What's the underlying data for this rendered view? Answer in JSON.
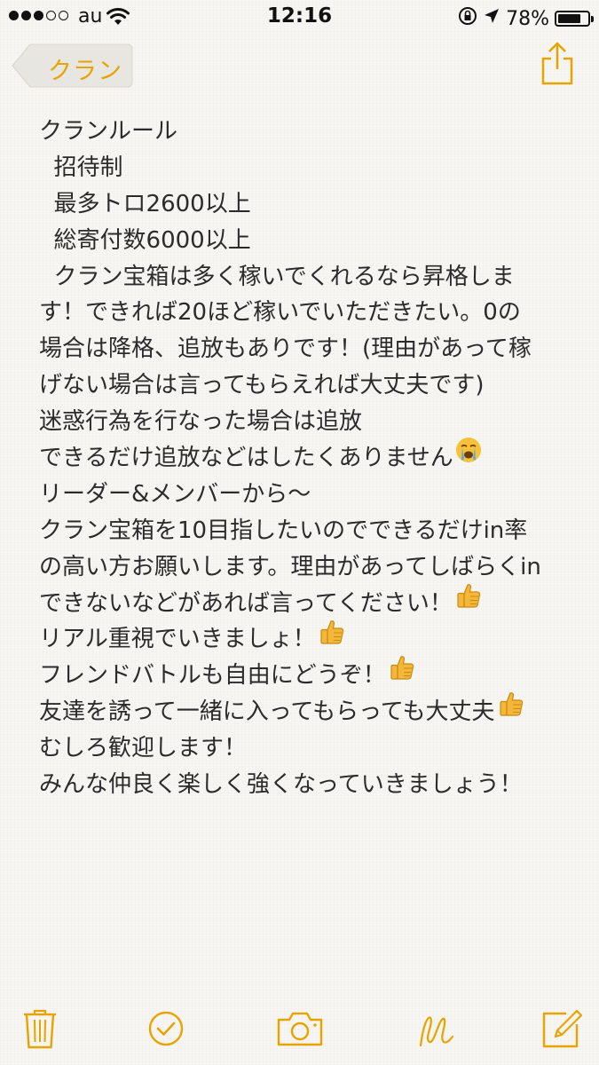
{
  "status_bar": {
    "carrier": "au",
    "time": "12:16",
    "battery": "78%",
    "battery_level": 0.78,
    "signal_bars_filled": 3,
    "signal_bars_total": 5
  },
  "nav": {
    "back_label": "クラン",
    "back_icon": "back-arrow-icon",
    "share_icon": "share-icon"
  },
  "note": {
    "lines": [
      "クランルール",
      "  招待制",
      "  最多トロ2600以上",
      "  総寄付数6000以上",
      "  クラン宝箱は多く稼いでくれるなら昇格しま",
      "す！できれば20ほど稼いでいただきたい。0の",
      "場合は降格、追放もありです！(理由があって稼",
      "げない場合は言ってもらえれば大丈夫です)",
      "迷惑行為を行なった場合は追放",
      "できるだけ追放などはしたくありません",
      "リーダー&メンバーから〜",
      "クラン宝箱を10目指したいのでできるだけin率",
      "の高い方お願いします。理由があってしばらくin",
      "できないなどがあれば言ってください！",
      "リアル重視でいきましょ！",
      "フレンドバトルも自由にどうぞ！",
      "友達を誘って一緒に入ってもらっても大丈夫",
      "むしろ歓迎します！",
      "みんな仲良く楽しく強くなっていきましょう！"
    ]
  },
  "toolbar": {
    "icons": [
      "trash-icon",
      "checklist-icon",
      "camera-icon",
      "sketch-icon",
      "compose-icon"
    ]
  },
  "colors": {
    "accent": "#e7a400",
    "text": "#2b2b2b",
    "paper": "#f7f6f3"
  }
}
